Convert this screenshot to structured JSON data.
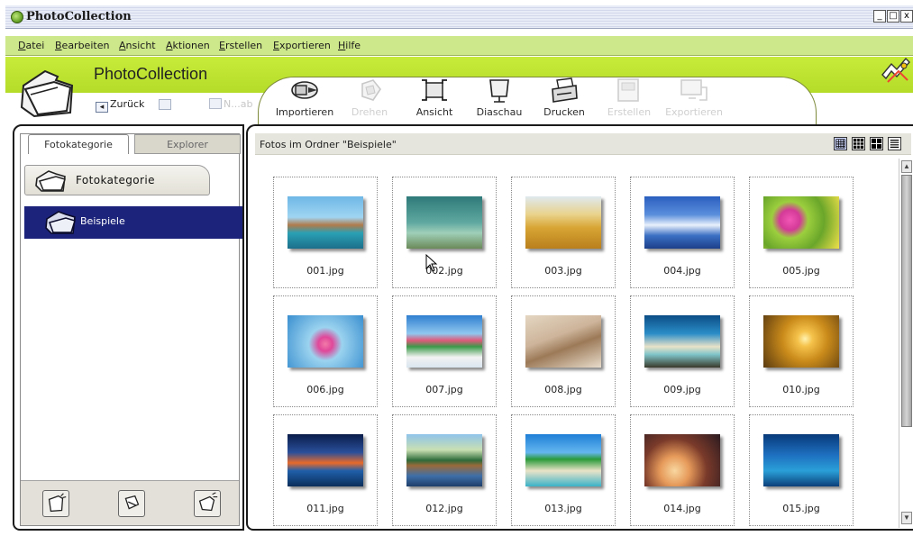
{
  "window": {
    "title": "PhotoCollection",
    "controls": {
      "minimize": "_",
      "maximize": "□",
      "close": "x"
    }
  },
  "menu": {
    "items": [
      "Datei",
      "Bearbeiten",
      "Ansicht",
      "Aktionen",
      "Erstellen",
      "Exportieren",
      "Hilfe"
    ]
  },
  "toolbar": {
    "app_name": "PhotoCollection",
    "back_label": "Zurück",
    "next_label": "N...ab",
    "buttons": [
      {
        "label": "Importieren",
        "icon": "import-icon",
        "enabled": true
      },
      {
        "label": "Drehen",
        "icon": "rotate-icon",
        "enabled": false
      },
      {
        "label": "Ansicht",
        "icon": "view-icon",
        "enabled": true
      },
      {
        "label": "Diaschau",
        "icon": "slideshow-icon",
        "enabled": true
      },
      {
        "label": "Drucken",
        "icon": "printer-icon",
        "enabled": true
      },
      {
        "label": "Erstellen",
        "icon": "create-icon",
        "enabled": false
      },
      {
        "label": "Exportieren",
        "icon": "export-icon",
        "enabled": false
      }
    ]
  },
  "sidebar": {
    "tabs": [
      {
        "label": "Fotokategorie",
        "active": true
      },
      {
        "label": "Explorer",
        "active": false
      }
    ],
    "category_header": "Fotokategorie",
    "folders": [
      {
        "label": "Beispiele",
        "selected": true
      }
    ],
    "bottom_buttons": [
      "new-category-icon",
      "edit-category-icon",
      "delete-category-icon"
    ]
  },
  "content": {
    "folder_title": "Fotos im Ordner \"Beispiele\"",
    "view_modes": [
      "small-grid-icon",
      "medium-grid-icon",
      "large-grid-icon",
      "list-view-icon"
    ],
    "photos": [
      {
        "name": "001.jpg"
      },
      {
        "name": "002.jpg"
      },
      {
        "name": "003.jpg"
      },
      {
        "name": "004.jpg"
      },
      {
        "name": "005.jpg"
      },
      {
        "name": "006.jpg"
      },
      {
        "name": "007.jpg"
      },
      {
        "name": "008.jpg"
      },
      {
        "name": "009.jpg"
      },
      {
        "name": "010.jpg"
      },
      {
        "name": "011.jpg"
      },
      {
        "name": "012.jpg"
      },
      {
        "name": "013.jpg"
      },
      {
        "name": "014.jpg"
      },
      {
        "name": "015.jpg"
      }
    ]
  },
  "colors": {
    "accent_green": "#c2e638",
    "menu_green": "#cde88a",
    "selection_blue": "#1c237a"
  }
}
